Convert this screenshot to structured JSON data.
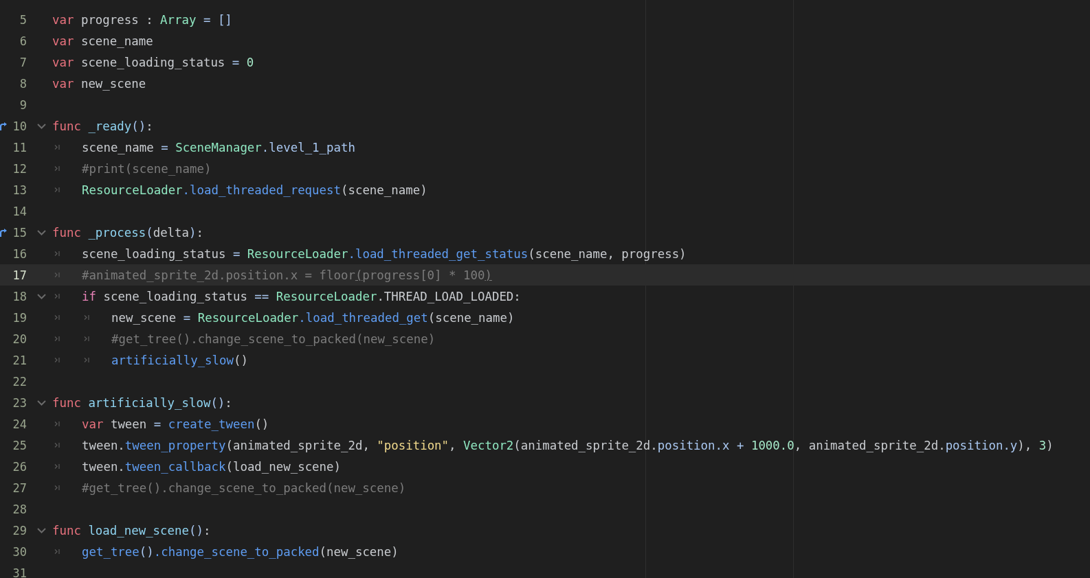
{
  "lines": [
    {
      "n": "5",
      "fold": false,
      "override": false,
      "current": false,
      "tokens": [
        {
          "kind": "kw",
          "t": "var"
        },
        {
          "kind": "plain",
          "t": " progress : "
        },
        {
          "kind": "cls",
          "t": "Array"
        },
        {
          "kind": "sym",
          "t": " = []"
        }
      ]
    },
    {
      "n": "6",
      "fold": false,
      "override": false,
      "current": false,
      "tokens": [
        {
          "kind": "kw",
          "t": "var"
        },
        {
          "kind": "plain",
          "t": " scene_name"
        }
      ]
    },
    {
      "n": "7",
      "fold": false,
      "override": false,
      "current": false,
      "tokens": [
        {
          "kind": "kw",
          "t": "var"
        },
        {
          "kind": "plain",
          "t": " scene_loading_status "
        },
        {
          "kind": "sym",
          "t": "= "
        },
        {
          "kind": "num",
          "t": "0"
        }
      ]
    },
    {
      "n": "8",
      "fold": false,
      "override": false,
      "current": false,
      "tokens": [
        {
          "kind": "kw",
          "t": "var"
        },
        {
          "kind": "plain",
          "t": " new_scene"
        }
      ]
    },
    {
      "n": "9",
      "fold": false,
      "override": false,
      "current": false
    },
    {
      "n": "10",
      "fold": true,
      "override": true,
      "current": false,
      "tokens": [
        {
          "kind": "kw",
          "t": "func"
        },
        {
          "kind": "def",
          "t": " _ready"
        },
        {
          "kind": "sym",
          "t": "()"
        },
        {
          "kind": "plain",
          "t": ":"
        }
      ]
    },
    {
      "n": "11",
      "fold": false,
      "override": false,
      "current": false,
      "tokens": [
        {
          "kind": "tab"
        },
        {
          "kind": "plain",
          "t": "scene_name "
        },
        {
          "kind": "sym",
          "t": "= "
        },
        {
          "kind": "cls",
          "t": "SceneManager"
        },
        {
          "kind": "prop",
          "t": ".level_1_path"
        }
      ]
    },
    {
      "n": "12",
      "fold": false,
      "override": false,
      "current": false,
      "tokens": [
        {
          "kind": "tab"
        },
        {
          "kind": "cmt",
          "t": "#print(scene_name)"
        }
      ]
    },
    {
      "n": "13",
      "fold": false,
      "override": false,
      "current": false,
      "tokens": [
        {
          "kind": "tab"
        },
        {
          "kind": "cls",
          "t": "ResourceLoader"
        },
        {
          "kind": "call",
          "t": ".load_threaded_request"
        },
        {
          "kind": "plain",
          "t": "(scene_name)"
        }
      ]
    },
    {
      "n": "14",
      "fold": false,
      "override": false,
      "current": false
    },
    {
      "n": "15",
      "fold": true,
      "override": true,
      "current": false,
      "tokens": [
        {
          "kind": "kw",
          "t": "func"
        },
        {
          "kind": "def",
          "t": " _process"
        },
        {
          "kind": "sym",
          "t": "("
        },
        {
          "kind": "plain",
          "t": "delta"
        },
        {
          "kind": "sym",
          "t": ")"
        },
        {
          "kind": "plain",
          "t": ":"
        }
      ]
    },
    {
      "n": "16",
      "fold": false,
      "override": false,
      "current": false,
      "tokens": [
        {
          "kind": "tab"
        },
        {
          "kind": "plain",
          "t": "scene_loading_status "
        },
        {
          "kind": "sym",
          "t": "= "
        },
        {
          "kind": "cls",
          "t": "ResourceLoader"
        },
        {
          "kind": "call",
          "t": ".load_threaded_get_status"
        },
        {
          "kind": "plain",
          "t": "(scene_name, progress)"
        }
      ]
    },
    {
      "n": "17",
      "fold": false,
      "override": false,
      "current": true,
      "tokens": [
        {
          "kind": "tab"
        },
        {
          "kind": "cmt",
          "t": "#animated_sprite_2d.position.x = floor"
        },
        {
          "kind": "match",
          "t": "("
        },
        {
          "kind": "cmt",
          "t": "progress[0] * 100"
        },
        {
          "kind": "match",
          "t": ")"
        }
      ]
    },
    {
      "n": "18",
      "fold": true,
      "override": false,
      "current": false,
      "tokens": [
        {
          "kind": "tab"
        },
        {
          "kind": "ctl",
          "t": "if"
        },
        {
          "kind": "plain",
          "t": " scene_loading_status "
        },
        {
          "kind": "sym",
          "t": "== "
        },
        {
          "kind": "cls",
          "t": "ResourceLoader"
        },
        {
          "kind": "plain",
          "t": ".THREAD_LOAD_LOADED:"
        }
      ]
    },
    {
      "n": "19",
      "fold": false,
      "override": false,
      "current": false,
      "tokens": [
        {
          "kind": "tab"
        },
        {
          "kind": "tab"
        },
        {
          "kind": "plain",
          "t": "new_scene "
        },
        {
          "kind": "sym",
          "t": "= "
        },
        {
          "kind": "cls",
          "t": "ResourceLoader"
        },
        {
          "kind": "call",
          "t": ".load_threaded_get"
        },
        {
          "kind": "plain",
          "t": "(scene_name)"
        }
      ]
    },
    {
      "n": "20",
      "fold": false,
      "override": false,
      "current": false,
      "tokens": [
        {
          "kind": "tab"
        },
        {
          "kind": "tab"
        },
        {
          "kind": "cmt",
          "t": "#get_tree().change_scene_to_packed(new_scene)"
        }
      ]
    },
    {
      "n": "21",
      "fold": false,
      "override": false,
      "current": false,
      "tokens": [
        {
          "kind": "tab"
        },
        {
          "kind": "tab"
        },
        {
          "kind": "call",
          "t": "artificially_slow"
        },
        {
          "kind": "plain",
          "t": "()"
        }
      ]
    },
    {
      "n": "22",
      "fold": false,
      "override": false,
      "current": false
    },
    {
      "n": "23",
      "fold": true,
      "override": false,
      "current": false,
      "tokens": [
        {
          "kind": "kw",
          "t": "func"
        },
        {
          "kind": "def",
          "t": " artificially_slow"
        },
        {
          "kind": "sym",
          "t": "()"
        },
        {
          "kind": "plain",
          "t": ":"
        }
      ]
    },
    {
      "n": "24",
      "fold": false,
      "override": false,
      "current": false,
      "tokens": [
        {
          "kind": "tab"
        },
        {
          "kind": "kw",
          "t": "var"
        },
        {
          "kind": "plain",
          "t": " tween "
        },
        {
          "kind": "sym",
          "t": "= "
        },
        {
          "kind": "call",
          "t": "create_tween"
        },
        {
          "kind": "plain",
          "t": "()"
        }
      ]
    },
    {
      "n": "25",
      "fold": false,
      "override": false,
      "current": false,
      "tokens": [
        {
          "kind": "tab"
        },
        {
          "kind": "plain",
          "t": "tween."
        },
        {
          "kind": "call",
          "t": "tween_property"
        },
        {
          "kind": "plain",
          "t": "(animated_sprite_2d, "
        },
        {
          "kind": "str",
          "t": "\"position\""
        },
        {
          "kind": "plain",
          "t": ", "
        },
        {
          "kind": "cls",
          "t": "Vector2"
        },
        {
          "kind": "plain",
          "t": "(animated_sprite_2d."
        },
        {
          "kind": "prop",
          "t": "position.x "
        },
        {
          "kind": "sym",
          "t": "+ "
        },
        {
          "kind": "num",
          "t": "1000.0"
        },
        {
          "kind": "plain",
          "t": ", animated_sprite_2d."
        },
        {
          "kind": "prop",
          "t": "position.y"
        },
        {
          "kind": "plain",
          "t": "), "
        },
        {
          "kind": "num",
          "t": "3"
        },
        {
          "kind": "plain",
          "t": ")"
        }
      ]
    },
    {
      "n": "26",
      "fold": false,
      "override": false,
      "current": false,
      "tokens": [
        {
          "kind": "tab"
        },
        {
          "kind": "plain",
          "t": "tween."
        },
        {
          "kind": "call",
          "t": "tween_callback"
        },
        {
          "kind": "plain",
          "t": "(load_new_scene)"
        }
      ]
    },
    {
      "n": "27",
      "fold": false,
      "override": false,
      "current": false,
      "tokens": [
        {
          "kind": "tab"
        },
        {
          "kind": "cmt",
          "t": "#get_tree().change_scene_to_packed(new_scene)"
        }
      ]
    },
    {
      "n": "28",
      "fold": false,
      "override": false,
      "current": false
    },
    {
      "n": "29",
      "fold": true,
      "override": false,
      "current": false,
      "tokens": [
        {
          "kind": "kw",
          "t": "func"
        },
        {
          "kind": "def",
          "t": " load_new_scene"
        },
        {
          "kind": "sym",
          "t": "()"
        },
        {
          "kind": "plain",
          "t": ":"
        }
      ]
    },
    {
      "n": "30",
      "fold": false,
      "override": false,
      "current": false,
      "tokens": [
        {
          "kind": "tab"
        },
        {
          "kind": "call",
          "t": "get_tree"
        },
        {
          "kind": "sym",
          "t": "()"
        },
        {
          "kind": "call",
          "t": ".change_scene_to_packed"
        },
        {
          "kind": "plain",
          "t": "(new_scene)"
        }
      ]
    },
    {
      "n": "31",
      "fold": false,
      "override": false,
      "current": false
    }
  ]
}
